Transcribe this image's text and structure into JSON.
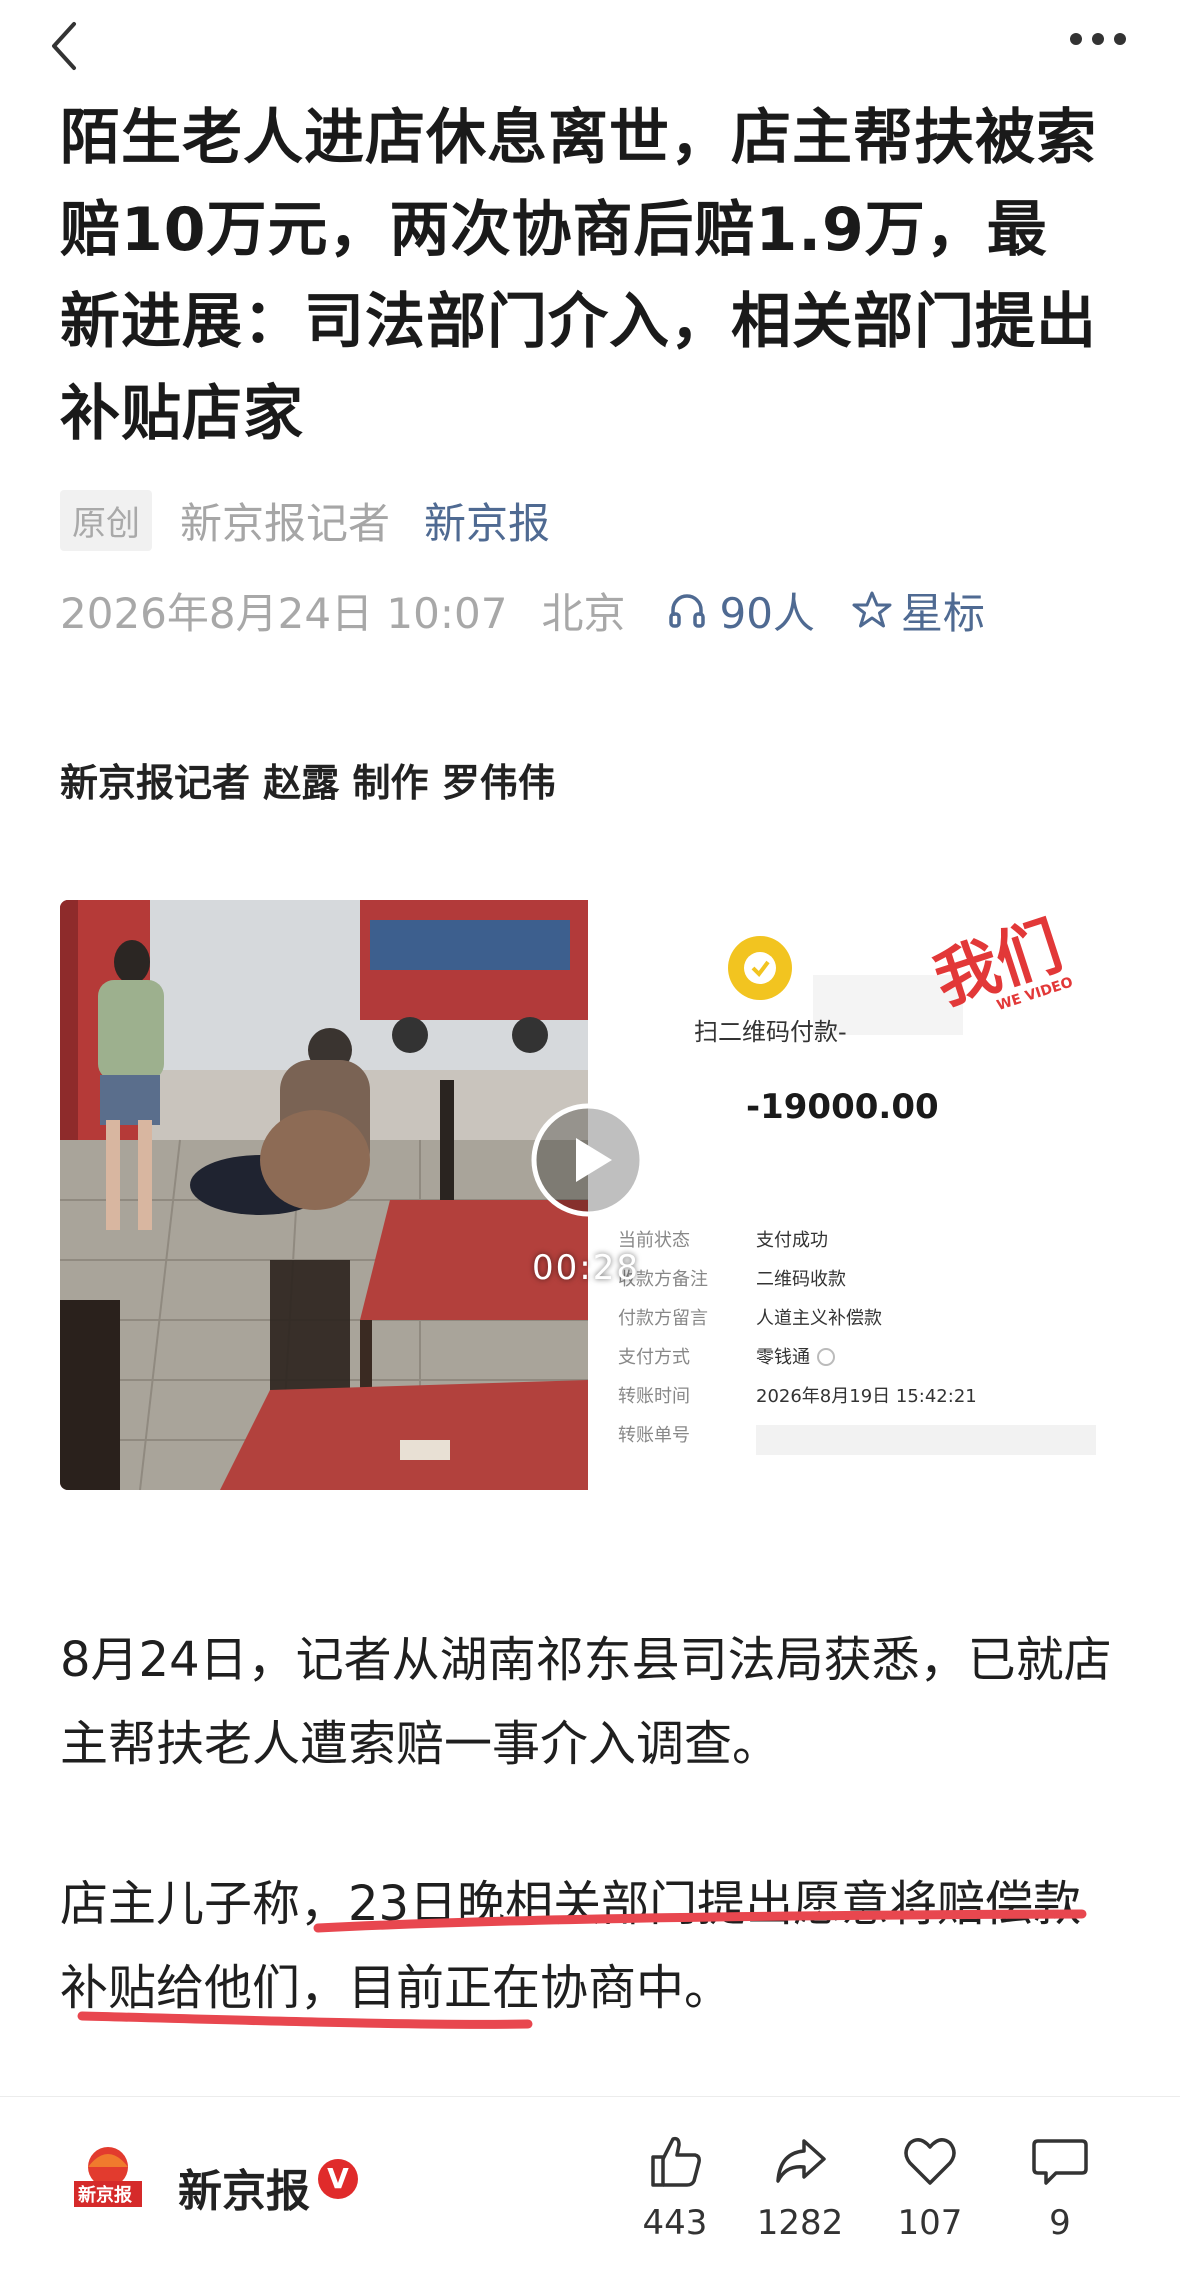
{
  "header": {
    "back_icon": "chevron-left-icon",
    "more_icon": "more-dots-icon"
  },
  "article": {
    "title": "陌生老人进店休息离世，店主帮扶被索赔10万元，两次协商后赔1.9万，最新进展：司法部门介入，相关部门提出补贴店家",
    "original_badge": "原创",
    "reporter_label": "新京报记者",
    "source": "新京报",
    "datetime": "2026年8月24日 10:07",
    "location": "北京",
    "listeners": "90人",
    "star_label": "星标",
    "credit_line": "新京报记者 赵露 制作 罗伟伟",
    "paragraph1": "8月24日，记者从湖南祁东县司法局获悉，已就店主帮扶老人遭索赔一事介入调查。",
    "paragraph2": "店主儿子称，23日晚相关部门提出愿意将赔偿款补贴给他们，目前正在协商中。",
    "underline_color": "#e8474f"
  },
  "video": {
    "duration": "00:28",
    "watermark": "我们",
    "watermark_sub": "WE VIDEO",
    "receipt": {
      "title": "扫二维码付款-",
      "amount": "-19000.00",
      "rows": [
        {
          "label": "当前状态",
          "value": "支付成功"
        },
        {
          "label": "收款方备注",
          "value": "二维码收款"
        },
        {
          "label": "付款方留言",
          "value": "人道主义补偿款"
        },
        {
          "label": "支付方式",
          "value": "零钱通"
        },
        {
          "label": "转账时间",
          "value": "2026年8月19日 15:42:21"
        },
        {
          "label": "转账单号",
          "value": ""
        }
      ]
    }
  },
  "footer": {
    "publisher": "新京报",
    "publisher_logo_text": "新京报",
    "verified": "V",
    "likes": "443",
    "shares": "1282",
    "favorites": "107",
    "comments": "9"
  }
}
